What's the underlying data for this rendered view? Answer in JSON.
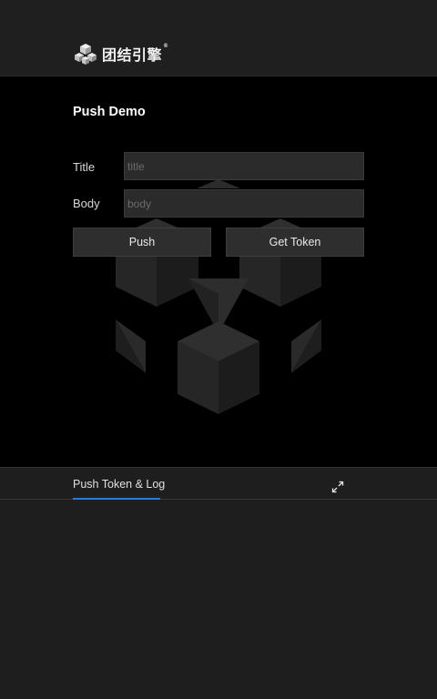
{
  "header": {
    "brand_name": "团结引擎",
    "brand_mark": "®",
    "logo_icon": "unity-cubes-logo-icon"
  },
  "main": {
    "title": "Push Demo",
    "fields": {
      "title_label": "Title",
      "title_placeholder": "title",
      "title_value": "",
      "body_label": "Body",
      "body_placeholder": "body",
      "body_value": ""
    },
    "buttons": {
      "push_label": "Push",
      "token_label": "Get Token"
    },
    "background_icon": "unity-cubes-background-icon"
  },
  "log": {
    "tab_label": "Push Token & Log",
    "expand_icon": "expand-icon",
    "accent_color": "#2a7ad6",
    "content": ""
  }
}
